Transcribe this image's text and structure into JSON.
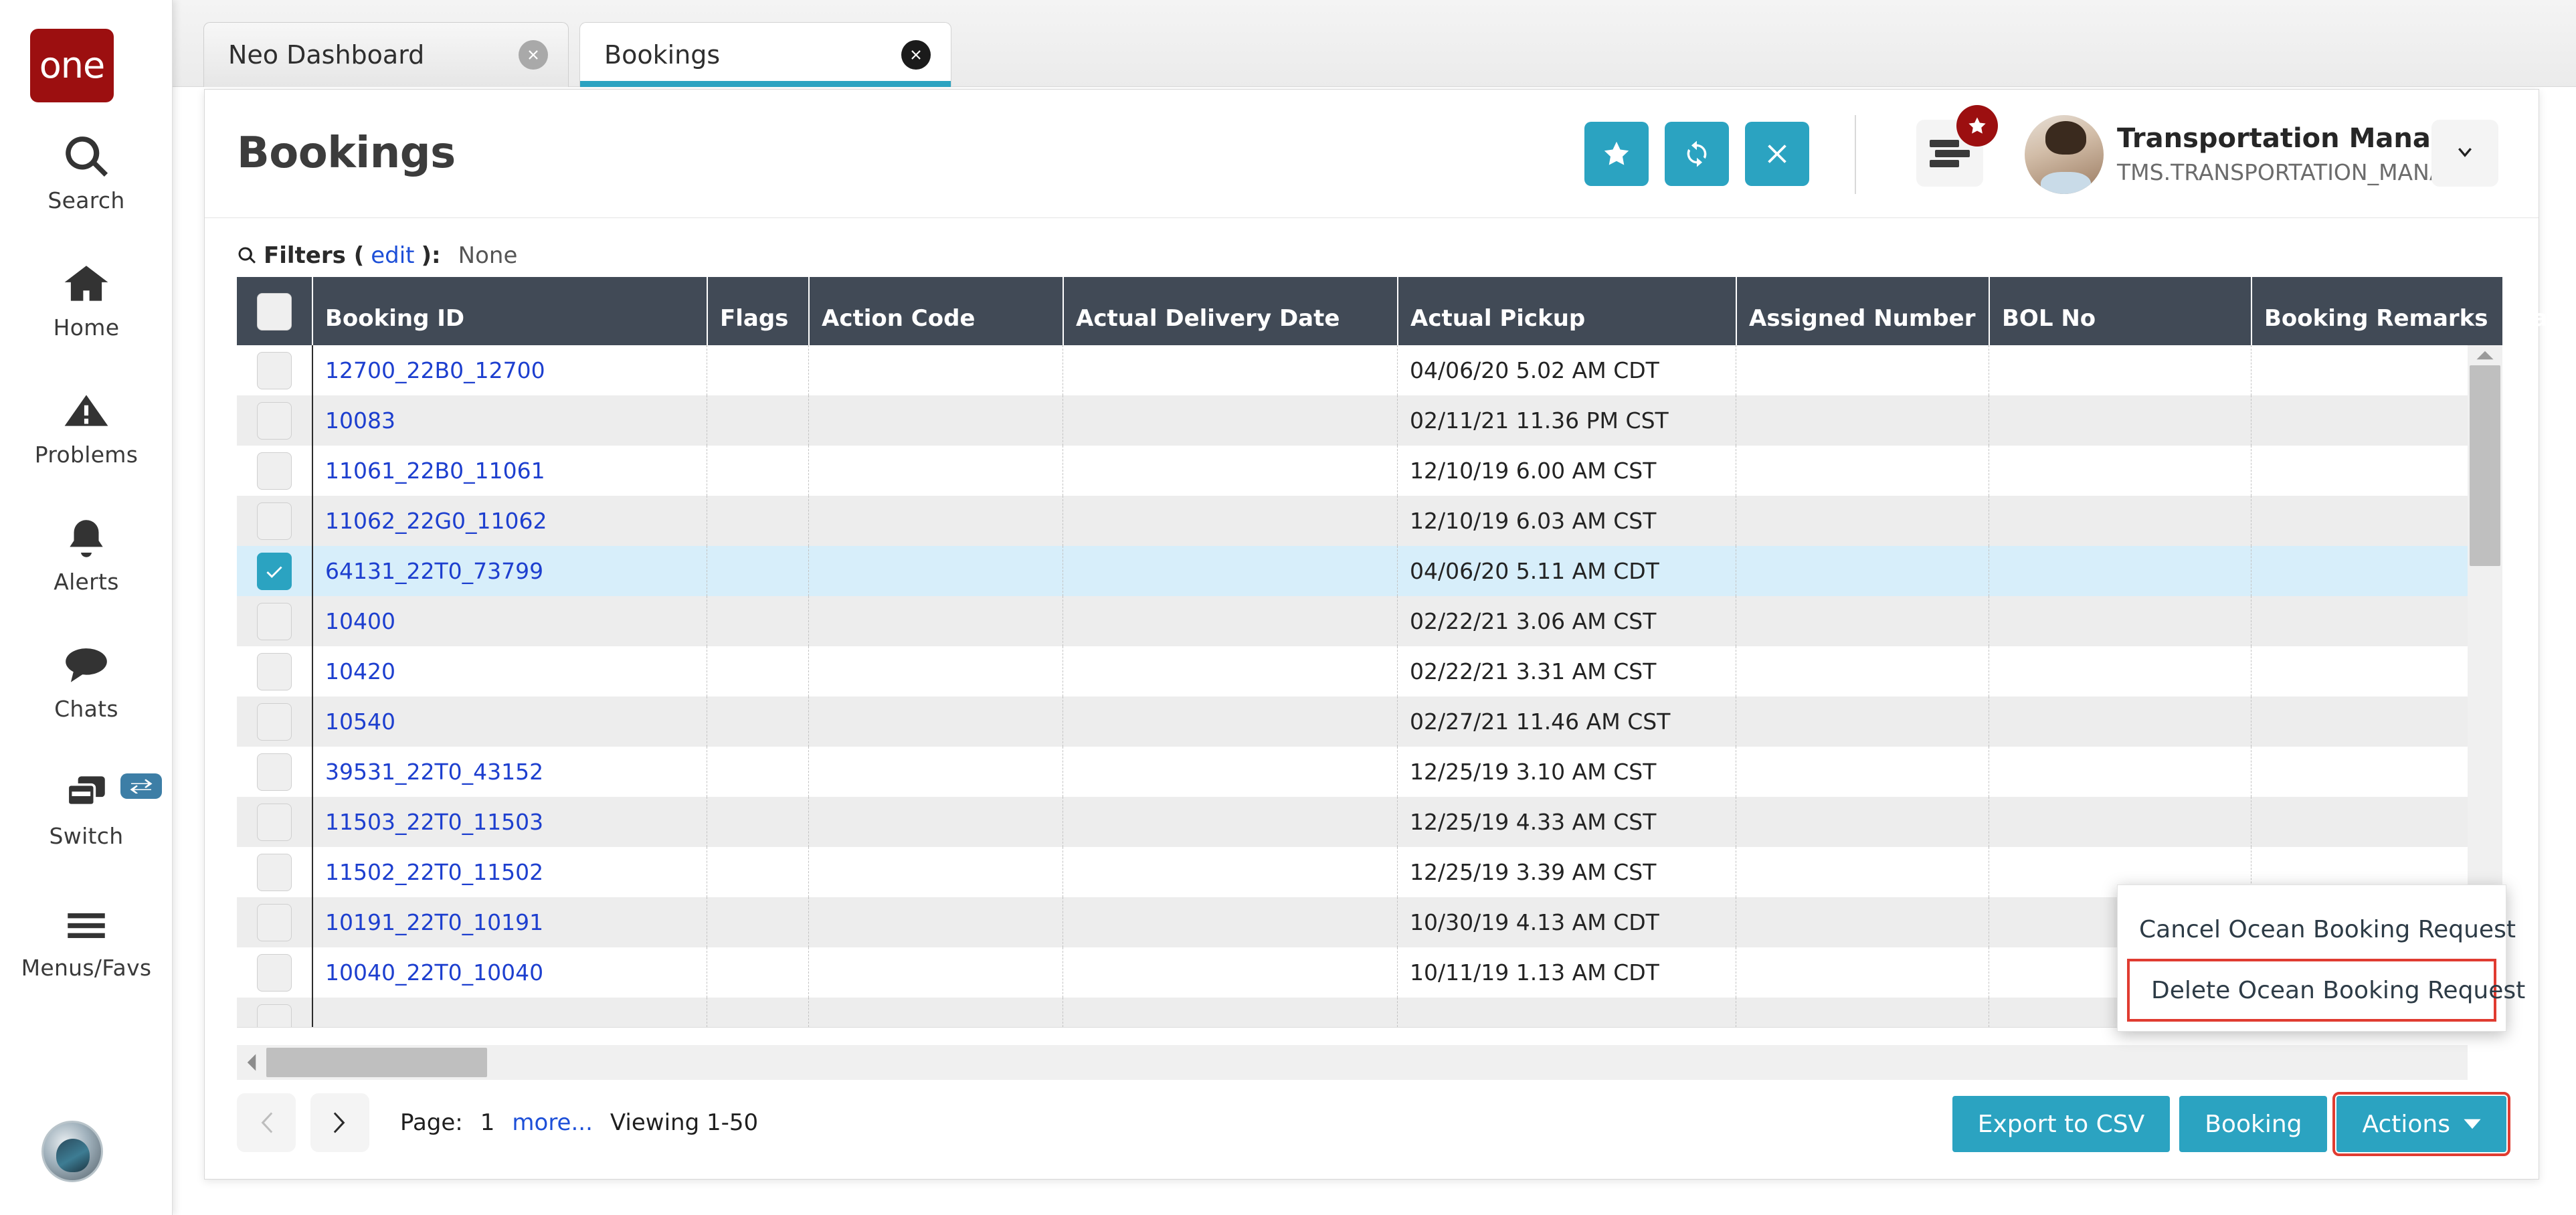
{
  "brand": {
    "logo_text": "one",
    "logo_color": "#9c0f10"
  },
  "theme": {
    "accent": "#2ba3c1",
    "header_bg": "#414a56",
    "link": "#1d3fcf",
    "highlight_outline": "#e03c31",
    "selected_row": "#d7eefa"
  },
  "rail": {
    "items": [
      {
        "label": "Search",
        "icon": "search-icon"
      },
      {
        "label": "Home",
        "icon": "home-icon"
      },
      {
        "label": "Problems",
        "icon": "warning-triangle-icon"
      },
      {
        "label": "Alerts",
        "icon": "bell-icon"
      },
      {
        "label": "Chats",
        "icon": "chat-bubble-icon"
      },
      {
        "label": "Switch",
        "icon": "switch-cards-icon",
        "badge_icon": "exchange-arrows-icon"
      },
      {
        "label": "Menus/Favs",
        "icon": "hamburger-icon"
      }
    ]
  },
  "tabs": [
    {
      "label": "Neo Dashboard",
      "active": false
    },
    {
      "label": "Bookings",
      "active": true
    }
  ],
  "header": {
    "title": "Bookings",
    "actions": [
      {
        "name": "favorite-button",
        "icon": "star-icon"
      },
      {
        "name": "refresh-button",
        "icon": "refresh-icon"
      },
      {
        "name": "close-button",
        "icon": "x-icon"
      }
    ],
    "menu_icon": "list-menu-icon",
    "menu_badge_icon": "star-icon",
    "user": {
      "name": "Transportation Manager",
      "role": "TMS.TRANSPORTATION_MANAGER"
    },
    "caret_icon": "chevron-down-icon"
  },
  "filters": {
    "icon": "search-icon",
    "label": "Filters (",
    "edit_label": "edit",
    "label_end": "):",
    "value": "None"
  },
  "table": {
    "columns": [
      "Booking ID",
      "Flags",
      "Action Code",
      "Actual Delivery Date",
      "Actual Pickup",
      "Assigned Number",
      "BOL No",
      "Booking Remarks",
      "Cargo"
    ],
    "rows": [
      {
        "id": "12700_22B0_12700",
        "flags": "",
        "action_code": "",
        "actual_delivery_date": "",
        "actual_pickup": "04/06/20 5.02 AM CDT",
        "assigned_number": "",
        "bol_no": "",
        "booking_remarks": "",
        "cargo": "",
        "selected": false
      },
      {
        "id": "10083",
        "flags": "",
        "action_code": "",
        "actual_delivery_date": "",
        "actual_pickup": "02/11/21 11.36 PM CST",
        "assigned_number": "",
        "bol_no": "",
        "booking_remarks": "",
        "cargo": "",
        "selected": false
      },
      {
        "id": "11061_22B0_11061",
        "flags": "",
        "action_code": "",
        "actual_delivery_date": "",
        "actual_pickup": "12/10/19 6.00 AM CST",
        "assigned_number": "",
        "bol_no": "",
        "booking_remarks": "",
        "cargo": "",
        "selected": false
      },
      {
        "id": "11062_22G0_11062",
        "flags": "",
        "action_code": "",
        "actual_delivery_date": "",
        "actual_pickup": "12/10/19 6.03 AM CST",
        "assigned_number": "",
        "bol_no": "",
        "booking_remarks": "",
        "cargo": "",
        "selected": false
      },
      {
        "id": "64131_22T0_73799",
        "flags": "",
        "action_code": "",
        "actual_delivery_date": "",
        "actual_pickup": "04/06/20 5.11 AM CDT",
        "assigned_number": "",
        "bol_no": "",
        "booking_remarks": "",
        "cargo": "",
        "selected": true
      },
      {
        "id": "10400",
        "flags": "",
        "action_code": "",
        "actual_delivery_date": "",
        "actual_pickup": "02/22/21 3.06 AM CST",
        "assigned_number": "",
        "bol_no": "",
        "booking_remarks": "",
        "cargo": "",
        "selected": false
      },
      {
        "id": "10420",
        "flags": "",
        "action_code": "",
        "actual_delivery_date": "",
        "actual_pickup": "02/22/21 3.31 AM CST",
        "assigned_number": "",
        "bol_no": "",
        "booking_remarks": "",
        "cargo": "",
        "selected": false
      },
      {
        "id": "10540",
        "flags": "",
        "action_code": "",
        "actual_delivery_date": "",
        "actual_pickup": "02/27/21 11.46 AM CST",
        "assigned_number": "",
        "bol_no": "",
        "booking_remarks": "",
        "cargo": "",
        "selected": false
      },
      {
        "id": "39531_22T0_43152",
        "flags": "",
        "action_code": "",
        "actual_delivery_date": "",
        "actual_pickup": "12/25/19 3.10 AM CST",
        "assigned_number": "",
        "bol_no": "",
        "booking_remarks": "",
        "cargo": "",
        "selected": false
      },
      {
        "id": "11503_22T0_11503",
        "flags": "",
        "action_code": "",
        "actual_delivery_date": "",
        "actual_pickup": "12/25/19 4.33 AM CST",
        "assigned_number": "",
        "bol_no": "",
        "booking_remarks": "",
        "cargo": "",
        "selected": false
      },
      {
        "id": "11502_22T0_11502",
        "flags": "",
        "action_code": "",
        "actual_delivery_date": "",
        "actual_pickup": "12/25/19 3.39 AM CST",
        "assigned_number": "",
        "bol_no": "",
        "booking_remarks": "",
        "cargo": "",
        "selected": false
      },
      {
        "id": "10191_22T0_10191",
        "flags": "",
        "action_code": "",
        "actual_delivery_date": "",
        "actual_pickup": "10/30/19 4.13 AM CDT",
        "assigned_number": "",
        "bol_no": "",
        "booking_remarks": "",
        "cargo": "",
        "selected": false
      },
      {
        "id": "10040_22T0_10040",
        "flags": "",
        "action_code": "",
        "actual_delivery_date": "",
        "actual_pickup": "10/11/19 1.13 AM CDT",
        "assigned_number": "",
        "bol_no": "",
        "booking_remarks": "",
        "cargo": "",
        "selected": false
      },
      {
        "id": "",
        "flags": "",
        "action_code": "",
        "actual_delivery_date": "",
        "actual_pickup": "",
        "assigned_number": "",
        "bol_no": "",
        "booking_remarks": "",
        "cargo": "",
        "selected": false
      }
    ]
  },
  "pagination": {
    "prev_icon": "chevron-left-icon",
    "next_icon": "chevron-right-icon",
    "page_label": "Page:",
    "page_number": "1",
    "more_label": "more...",
    "viewing_label": "Viewing 1-50"
  },
  "footer_buttons": [
    {
      "label": "Export to CSV",
      "name": "export-to-csv-button",
      "highlighted": false,
      "caret": false
    },
    {
      "label": "Booking",
      "name": "booking-button",
      "highlighted": false,
      "caret": false
    },
    {
      "label": "Actions",
      "name": "actions-button",
      "highlighted": true,
      "caret": true
    }
  ],
  "actions_dropdown": {
    "items": [
      {
        "label": "Cancel Ocean Booking Request",
        "highlighted": false
      },
      {
        "label": "Delete Ocean Booking Request",
        "highlighted": true
      }
    ]
  }
}
